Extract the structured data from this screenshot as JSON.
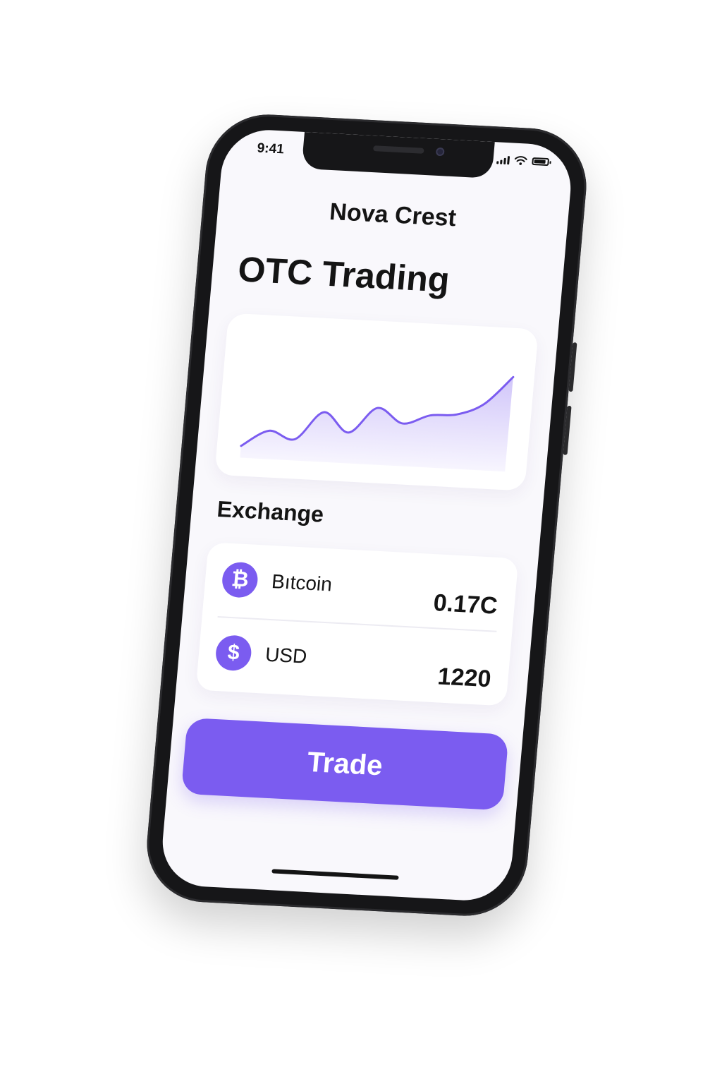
{
  "status_bar": {
    "time": "9:41"
  },
  "app": {
    "brand": "Nova Crest",
    "title": "OTC Trading"
  },
  "exchange": {
    "label": "Exchange",
    "rows": [
      {
        "icon": "bitcoin-icon",
        "symbol": "₿",
        "name": "Bıtcoin",
        "amount": "0.17C"
      },
      {
        "icon": "dollar-icon",
        "symbol": "$",
        "name": "USD",
        "amount": "1220"
      }
    ]
  },
  "actions": {
    "trade_label": "Trade"
  },
  "colors": {
    "accent": "#7b5cf0",
    "background": "#f9f8fc",
    "frame": "#161618"
  },
  "chart_data": {
    "type": "area",
    "title": "",
    "xlabel": "",
    "ylabel": "",
    "grid": false,
    "x": [
      0,
      1,
      2,
      3,
      4,
      5,
      6,
      7,
      8,
      9,
      10
    ],
    "series": [
      {
        "values": [
          10,
          24,
          18,
          42,
          26,
          48,
          36,
          44,
          46,
          56,
          80
        ]
      }
    ],
    "ylim": [
      0,
      100
    ]
  }
}
